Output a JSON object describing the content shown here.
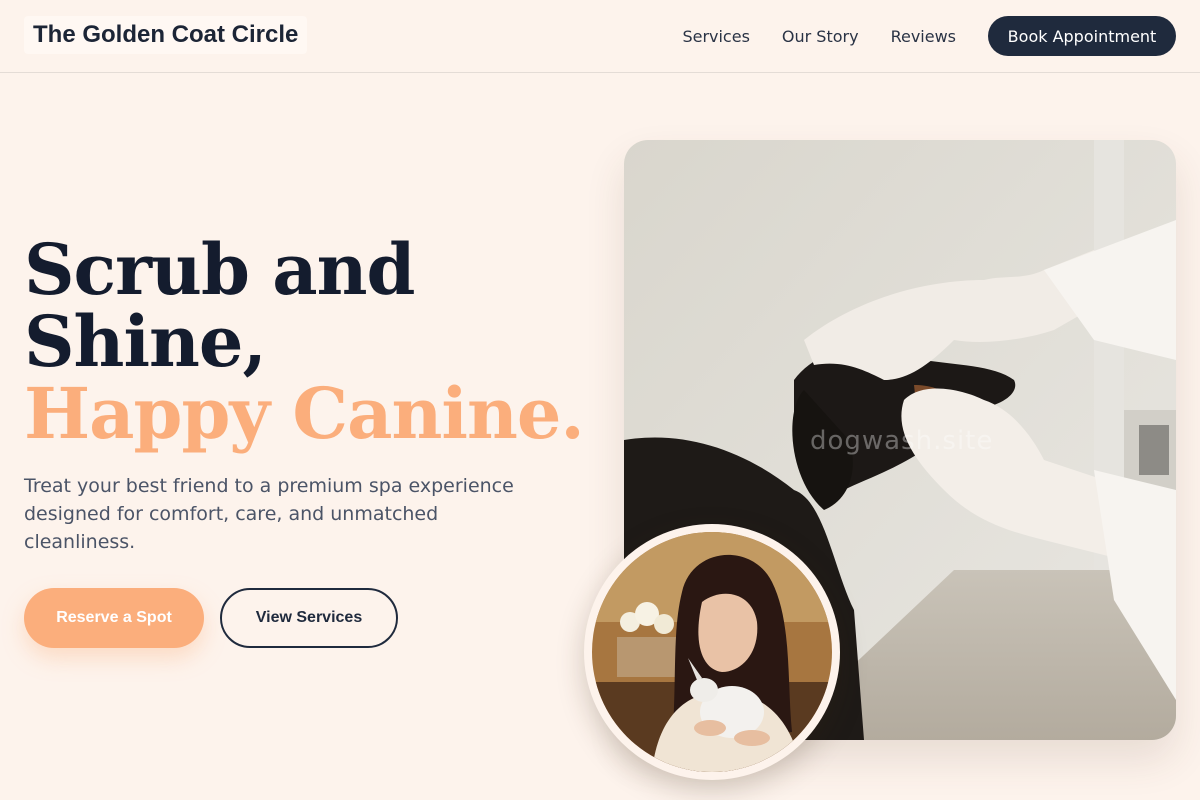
{
  "header": {
    "brand": "The Golden Coat Circle",
    "nav": [
      {
        "label": "Services"
      },
      {
        "label": "Our Story"
      },
      {
        "label": "Reviews"
      }
    ],
    "cta_label": "Book Appointment"
  },
  "hero": {
    "headline_line1": "Scrub and",
    "headline_line2": "Shine,",
    "headline_accent": "Happy Canine.",
    "subtext": "Treat your best friend to a premium spa experience designed for comfort, care, and unmatched cleanliness.",
    "primary_button": "Reserve a Spot",
    "secondary_button": "View Services"
  },
  "images": {
    "main_watermark": "dogwash.site"
  },
  "colors": {
    "background": "#fdf3ec",
    "navy": "#1f2a3d",
    "accent_peach": "#fbae7c"
  }
}
